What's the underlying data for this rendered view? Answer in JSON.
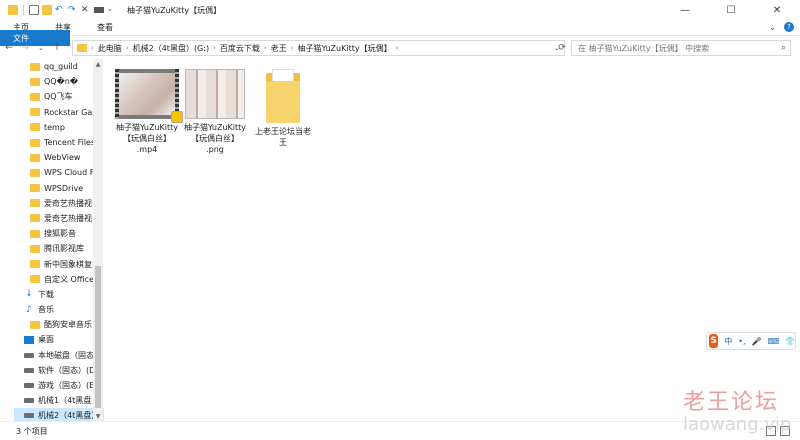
{
  "window": {
    "title": "柚子猫YuZuKitty【玩偶】",
    "controls": {
      "minimize": "—",
      "maximize": "☐",
      "close": "✕"
    }
  },
  "ribbon": {
    "tabs": [
      "文件",
      "主页",
      "共享",
      "查看"
    ],
    "expand": "⌄",
    "help": "?"
  },
  "nav": {
    "back": "←",
    "forward": "→",
    "recent": "⌄",
    "up": "↑",
    "refresh": "⟳"
  },
  "address": {
    "crumbs": [
      "此电脑",
      "机械2（4t黑盘）(G:)",
      "百度云下载",
      "老王",
      "柚子猫YuZuKitty【玩偶】"
    ],
    "chev": "›",
    "dropdown": "⌄"
  },
  "search": {
    "placeholder": "在 柚子猫YuZuKitty【玩偶】 中搜索",
    "icon": "⌕"
  },
  "sidebar": {
    "items": [
      {
        "label": "qq_guild",
        "icon": "folder"
      },
      {
        "label": "QQ�n�",
        "icon": "folder"
      },
      {
        "label": "QQ飞车",
        "icon": "folder"
      },
      {
        "label": "Rockstar Gam",
        "icon": "folder"
      },
      {
        "label": "temp",
        "icon": "folder"
      },
      {
        "label": "Tencent Files",
        "icon": "folder"
      },
      {
        "label": "WebView",
        "icon": "folder"
      },
      {
        "label": "WPS Cloud Fi",
        "icon": "folder"
      },
      {
        "label": "WPSDrive",
        "icon": "folder"
      },
      {
        "label": "爱奇艺热播视",
        "icon": "folder"
      },
      {
        "label": "爱奇艺热播视",
        "icon": "folder"
      },
      {
        "label": "搜狐影音",
        "icon": "folder"
      },
      {
        "label": "腾讯影视库",
        "icon": "folder"
      },
      {
        "label": "新中国象棋复盘",
        "icon": "folder"
      },
      {
        "label": "自定义 Office",
        "icon": "folder"
      },
      {
        "label": "下载",
        "icon": "download"
      },
      {
        "label": "音乐",
        "icon": "music"
      },
      {
        "label": "酷狗安卓音乐",
        "icon": "folder"
      },
      {
        "label": "桌面",
        "icon": "desktop"
      },
      {
        "label": "本地磁盘（固态",
        "icon": "drive"
      },
      {
        "label": "软件（固态）(D",
        "icon": "drive"
      },
      {
        "label": "游戏（固态）(E",
        "icon": "drive"
      },
      {
        "label": "机械1（4t黑盘",
        "icon": "drive"
      },
      {
        "label": "机械2（4t黑盘）",
        "icon": "drive",
        "selected": true
      }
    ],
    "scroll_up": "▲",
    "scroll_down": "▼"
  },
  "files": [
    {
      "name_line1": "柚子猫YuZuKitty",
      "name_line2": "【玩偶白丝】",
      "name_line3": ".mp4",
      "type": "video"
    },
    {
      "name_line1": "柚子猫YuZuKitty",
      "name_line2": "【玩偶白丝】",
      "name_line3": ".png",
      "type": "image"
    },
    {
      "name_line1": "上老王论坛当老",
      "name_line2": "王",
      "name_line3": "",
      "type": "folder"
    }
  ],
  "status": {
    "count": "3 个项目"
  },
  "ime": {
    "logo": "S",
    "lang": "中",
    "punct": "•,",
    "mic": "🎤",
    "keyboard": "⌨",
    "extra": "👕"
  },
  "watermark": {
    "line1": "老王论坛",
    "line2": "laowang.vip"
  }
}
